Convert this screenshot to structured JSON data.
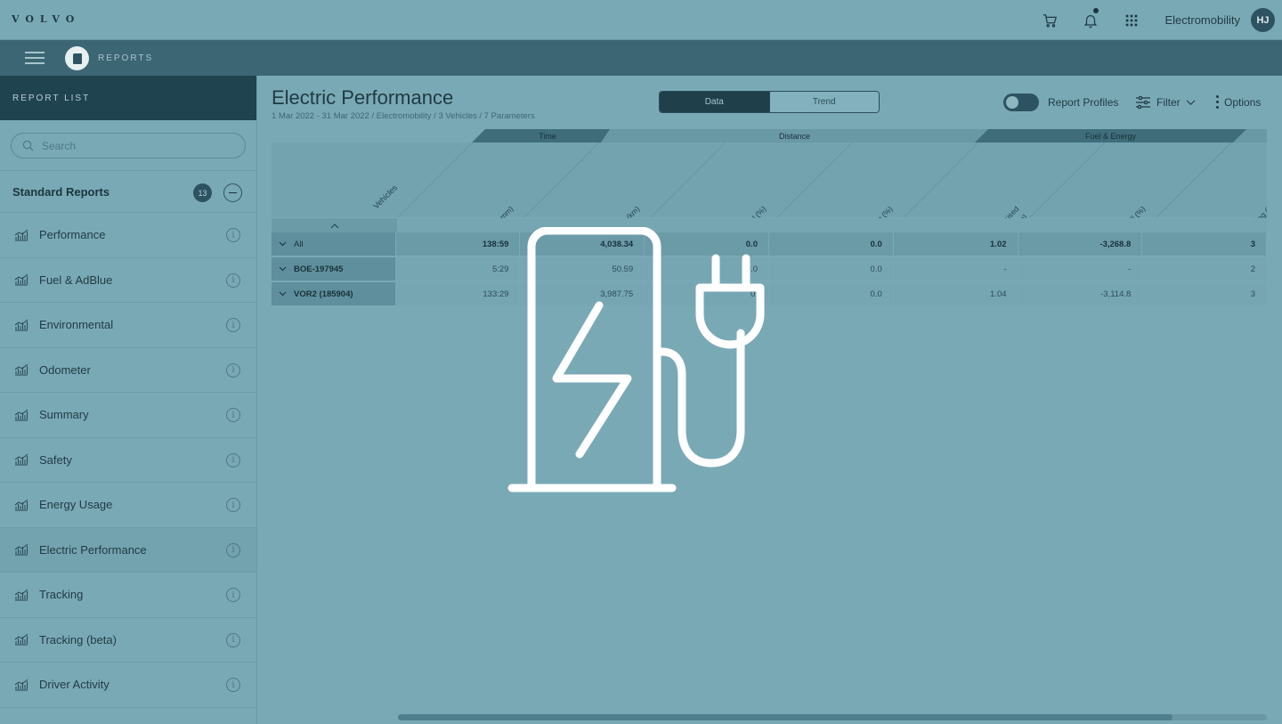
{
  "brand": "VOLVO",
  "topbar": {
    "account_name": "Electromobility",
    "avatar_initials": "HJ"
  },
  "app": {
    "title": "REPORTS"
  },
  "sidebar": {
    "header": "REPORT LIST",
    "search_placeholder": "Search",
    "group_title": "Standard Reports",
    "group_count": "13",
    "items": [
      {
        "label": "Performance"
      },
      {
        "label": "Fuel & AdBlue"
      },
      {
        "label": "Environmental"
      },
      {
        "label": "Odometer"
      },
      {
        "label": "Summary"
      },
      {
        "label": "Safety"
      },
      {
        "label": "Energy Usage"
      },
      {
        "label": "Electric Performance"
      },
      {
        "label": "Tracking"
      },
      {
        "label": "Tracking (beta)"
      },
      {
        "label": "Driver Activity"
      }
    ],
    "info_glyph": "i"
  },
  "main": {
    "title": "Electric Performance",
    "subtitle": "1 Mar 2022 - 31 Mar 2022 / Electromobility / 3 Vehicles / 7 Parameters",
    "view_tabs": [
      "Data",
      "Trend"
    ],
    "report_profiles_label": "Report Profiles",
    "filter_label": "Filter",
    "options_label": "Options"
  },
  "table": {
    "groups": [
      "Time",
      "Distance",
      "Fuel & Energy"
    ],
    "vehicles_label": "Vehicles",
    "columns": [
      [
        "Total (hh:mm)"
      ],
      [
        "Driving (km)"
      ],
      [
        "Cruise control (%)"
      ],
      [
        "Recuperation (%)"
      ],
      [
        "Avg energy used",
        "(kWh/100km)"
      ],
      [
        "Standstill (%)"
      ],
      [
        "Avg Driving (k"
      ]
    ],
    "rows": [
      {
        "name": "All",
        "values": [
          "138:59",
          "4,038.34",
          "0.0",
          "0.0",
          "1.02",
          "-3,268.8",
          "3"
        ]
      },
      {
        "name": "BOE-197945",
        "values": [
          "5:29",
          "50.59",
          "0.0",
          "0.0",
          "-",
          "-",
          "2"
        ]
      },
      {
        "name": "VOR2 (185904)",
        "values": [
          "133:29",
          "3,987.75",
          "0.",
          "0.0",
          "1.04",
          "-3,114.8",
          "3"
        ]
      }
    ]
  },
  "overlay": {
    "icon": "ev-charger-icon"
  },
  "colors": {
    "background": "#7aa9b6",
    "subbar": "#3c6674",
    "sidebar_header": "#204350",
    "active_tab": "#1f3f4b",
    "overlay_icon": "#ffffff"
  }
}
